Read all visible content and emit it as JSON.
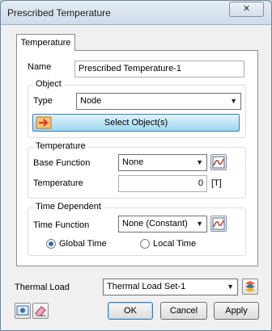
{
  "window": {
    "title": "Prescribed Temperature",
    "close_label": "✕"
  },
  "tabs": [
    {
      "label": "Temperature"
    }
  ],
  "name_field": {
    "label": "Name",
    "value": "Prescribed Temperature-1"
  },
  "object_group": {
    "title": "Object",
    "type_label": "Type",
    "type_value": "Node",
    "select_button": "Select Object(s)"
  },
  "temperature_group": {
    "title": "Temperature",
    "base_function_label": "Base Function",
    "base_function_value": "None",
    "temperature_label": "Temperature",
    "temperature_value": "0",
    "unit": "[T]"
  },
  "time_group": {
    "title": "Time Dependent",
    "time_function_label": "Time Function",
    "time_function_value": "None (Constant)",
    "global_time_label": "Global Time",
    "local_time_label": "Local Time",
    "selected": "global"
  },
  "thermal_load": {
    "label": "Thermal Load",
    "value": "Thermal Load Set-1"
  },
  "buttons": {
    "ok": "OK",
    "cancel": "Cancel",
    "apply": "Apply"
  },
  "colors": {
    "accent": "#3c7fb1",
    "select_button": "#9fd6f0",
    "titlebar": "#cfdbe9"
  },
  "icons": [
    "function-graph-icon",
    "select-arrow-icon",
    "layers-icon",
    "screen-capture-icon",
    "eraser-icon",
    "close-icon",
    "dropdown-arrow-icon"
  ]
}
